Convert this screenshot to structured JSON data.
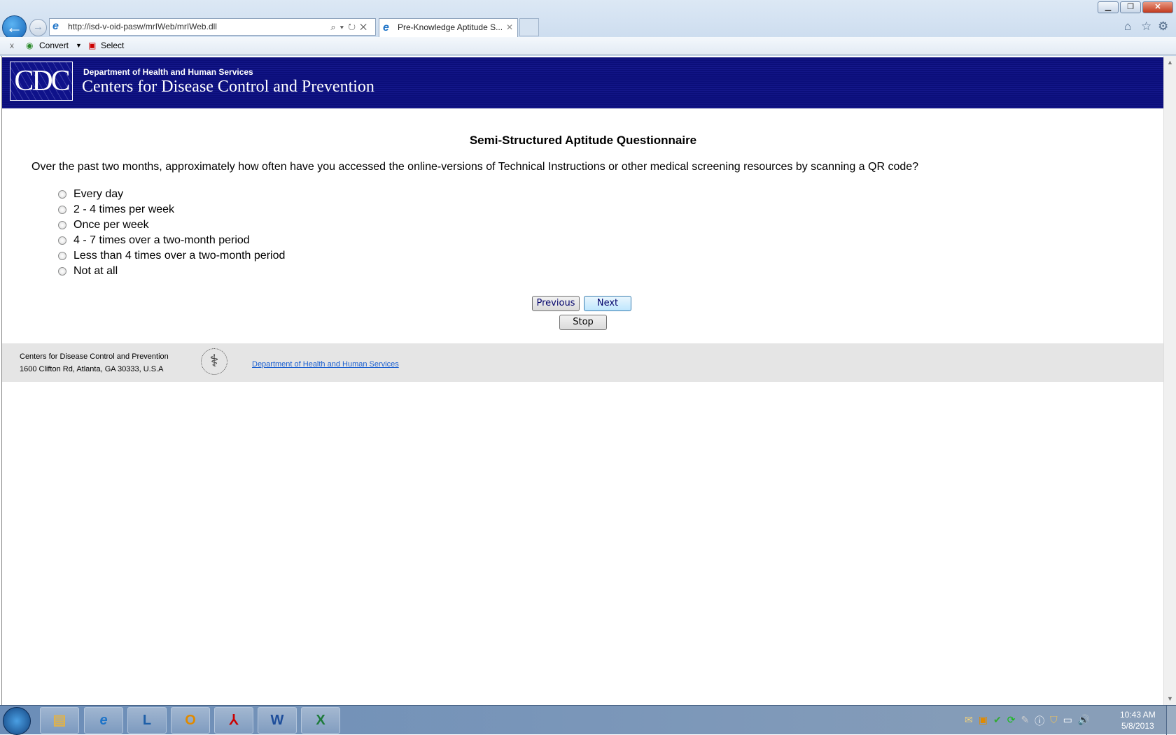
{
  "browser": {
    "url": "http://isd-v-oid-pasw/mrIWeb/mrIWeb.dll",
    "tab_title": "Pre-Knowledge Aptitude S...",
    "toolbar": {
      "close": "x",
      "convert": "Convert",
      "select": "Select"
    }
  },
  "header": {
    "logo": "CDC",
    "department": "Department of Health and Human Services",
    "agency": "Centers for Disease Control and Prevention"
  },
  "survey": {
    "title": "Semi-Structured Aptitude Questionnaire",
    "question": "Over the past two months, approximately how often have you accessed the online-versions of Technical Instructions or other medical screening resources by scanning a QR code?",
    "options": [
      "Every day",
      "2 - 4 times per week",
      "Once per week",
      "4 - 7 times over a two-month period",
      "Less than 4 times over a two-month period",
      "Not at all"
    ],
    "previous": "Previous",
    "next": "Next",
    "stop": "Stop"
  },
  "footer": {
    "line1": "Centers for Disease Control and Prevention",
    "line2": "1600 Clifton Rd, Atlanta, GA 30333, U.S.A",
    "link": "Department of Health and Human Services"
  },
  "taskbar": {
    "time": "10:43 AM",
    "date": "5/8/2013"
  }
}
